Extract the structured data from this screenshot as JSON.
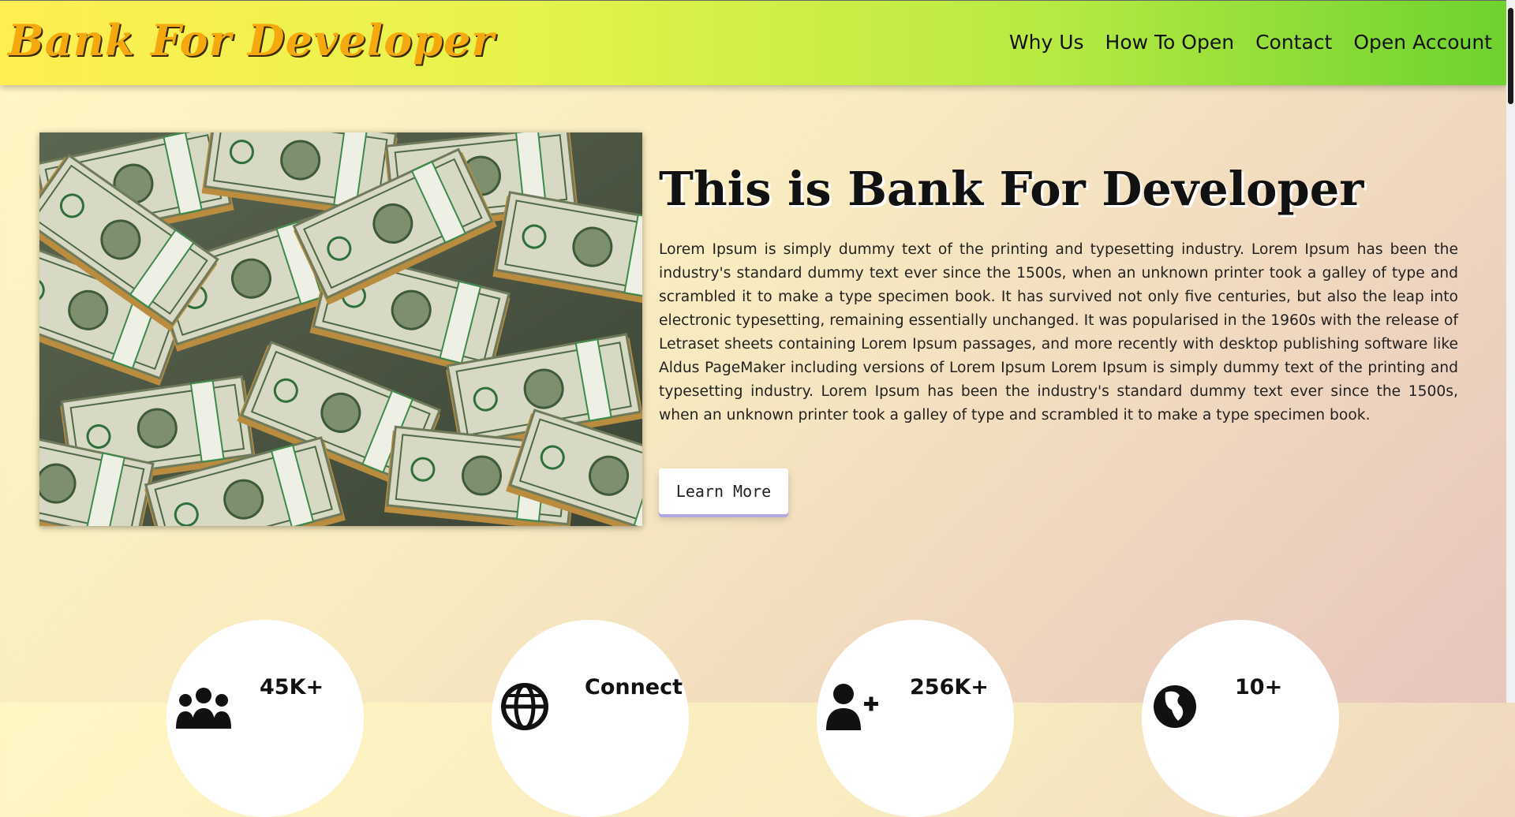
{
  "brand": {
    "title": "Bank For Developer"
  },
  "nav": {
    "items": [
      "Why Us",
      "How To Open",
      "Contact",
      "Open Account"
    ]
  },
  "hero": {
    "image_icon": "money-stack-image",
    "title": "This is Bank For Developer",
    "text": "Lorem Ipsum is simply dummy text of the printing and typesetting industry. Lorem Ipsum has been the industry's standard dummy text ever since the 1500s, when an unknown printer took a galley of type and scrambled it to make a type specimen book. It has survived not only five centuries, but also the leap into electronic typesetting, remaining essentially unchanged. It was popularised in the 1960s with the release of Letraset sheets containing Lorem Ipsum passages, and more recently with desktop publishing software like Aldus PageMaker including versions of Lorem Ipsum Lorem Ipsum is simply dummy text of the printing and typesetting industry. Lorem Ipsum has been the industry's standard dummy text ever since the 1500s, when an unknown printer took a galley of type and scrambled it to make a type specimen book.",
    "button_label": "Learn More"
  },
  "stats": [
    {
      "icon": "users-icon",
      "value": "45K+"
    },
    {
      "icon": "globe-icon",
      "value": "Connect"
    },
    {
      "icon": "add-user-icon",
      "value": "256K+"
    },
    {
      "icon": "globe-africa-icon",
      "value": "10+"
    }
  ],
  "colors": {
    "brand": "#f6a90f",
    "nav_start": "#ffee52",
    "nav_end": "#6ed22f",
    "button_shadow": "#b4a6e0"
  }
}
